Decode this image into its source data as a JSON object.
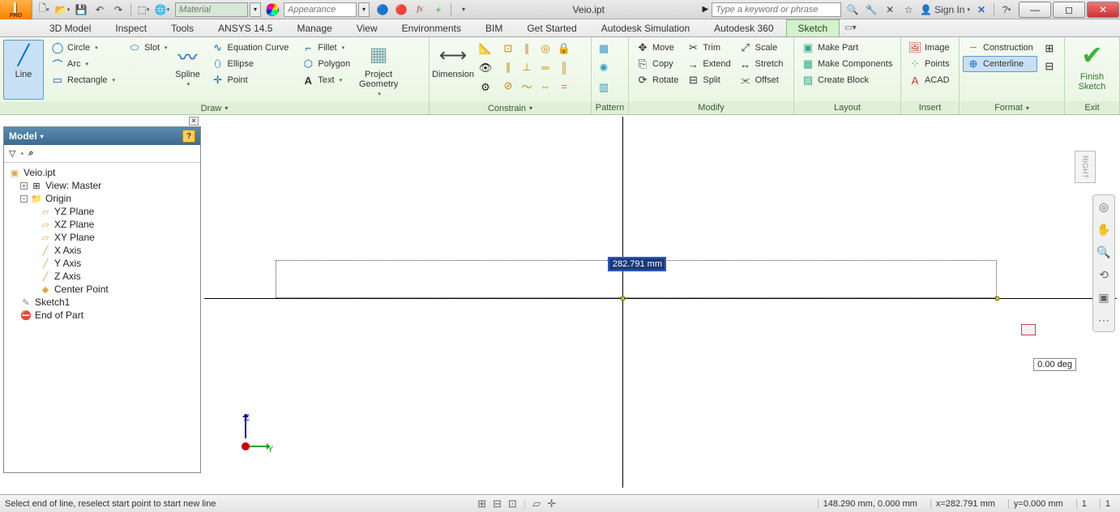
{
  "document_title": "Veio.ipt",
  "qat": {
    "material_placeholder": "Material",
    "appearance_placeholder": "Appearance",
    "search_placeholder": "Type a keyword or phrase",
    "sign_in": "Sign In"
  },
  "tabs": [
    "3D Model",
    "Inspect",
    "Tools",
    "ANSYS 14.5",
    "Manage",
    "View",
    "Environments",
    "BIM",
    "Get Started",
    "Autodesk Simulation",
    "Autodesk 360",
    "Sketch"
  ],
  "active_tab": "Sketch",
  "ribbon": {
    "draw": {
      "title": "Draw",
      "line": "Line",
      "circle": "Circle",
      "arc": "Arc",
      "rectangle": "Rectangle",
      "slot": "Slot",
      "spline": "Spline",
      "eqcurve": "Equation Curve",
      "ellipse": "Ellipse",
      "point": "Point",
      "fillet": "Fillet",
      "polygon": "Polygon",
      "text": "Text",
      "projgeom": "Project\nGeometry"
    },
    "constrain": {
      "title": "Constrain",
      "dimension": "Dimension"
    },
    "pattern": {
      "title": "Pattern"
    },
    "modify": {
      "title": "Modify",
      "move": "Move",
      "copy": "Copy",
      "rotate": "Rotate",
      "trim": "Trim",
      "extend": "Extend",
      "split": "Split",
      "scale": "Scale",
      "stretch": "Stretch",
      "offset": "Offset"
    },
    "layout": {
      "title": "Layout",
      "makepart": "Make Part",
      "makecomp": "Make Components",
      "createblock": "Create Block"
    },
    "insert": {
      "title": "Insert",
      "image": "Image",
      "points": "Points",
      "acad": "ACAD"
    },
    "format": {
      "title": "Format",
      "construction": "Construction",
      "centerline": "Centerline"
    },
    "finish": "Finish\nSketch",
    "exit": "Exit"
  },
  "browser": {
    "title": "Model",
    "root": "Veio.ipt",
    "view": "View: Master",
    "origin": "Origin",
    "planes": [
      "YZ Plane",
      "XZ Plane",
      "XY Plane",
      "X Axis",
      "Y Axis",
      "Z Axis",
      "Center Point"
    ],
    "sketch": "Sketch1",
    "eop": "End of Part"
  },
  "canvas": {
    "dim_value": "282.791 mm",
    "angle": "0.00 deg",
    "axis_z": "Z",
    "axis_y": "Y",
    "right": "RIGHT"
  },
  "status": {
    "prompt": "Select end of line, reselect start point to start new line",
    "size": "148.290 mm, 0.000 mm",
    "x": "x=282.791 mm",
    "y": "y=0.000 mm",
    "n1": "1",
    "n2": "1"
  }
}
